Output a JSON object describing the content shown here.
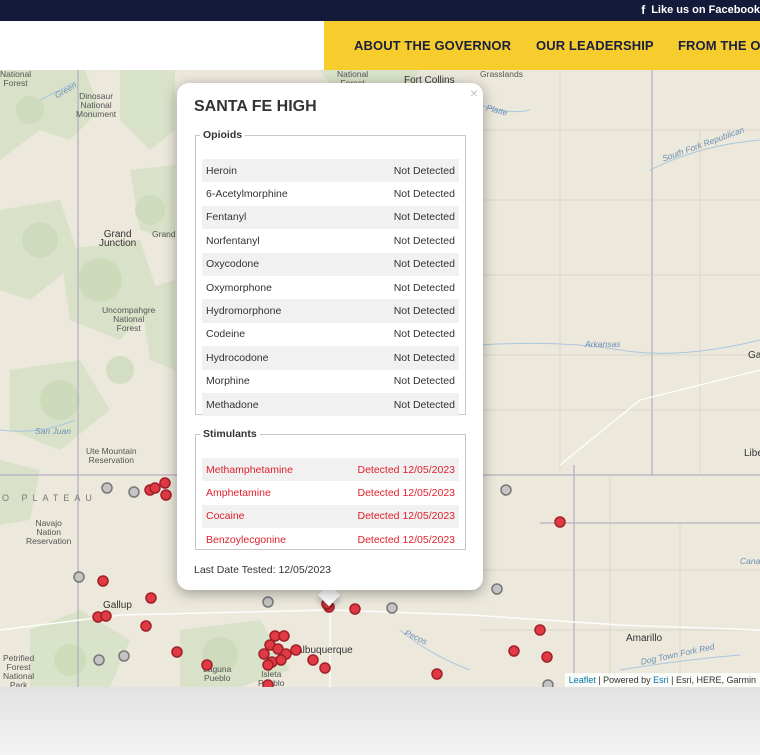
{
  "topbar": {
    "facebook_text": "Like us on Facebook",
    "facebook_icon": "facebook-icon"
  },
  "nav": {
    "items": [
      "ABOUT THE GOVERNOR",
      "OUR LEADERSHIP",
      "FROM THE OFFICE"
    ]
  },
  "colors": {
    "nav_bg": "#f7cd2e",
    "topbar_bg": "#141a3a",
    "detected": "#e0202c",
    "marker_red": "#e03a44",
    "marker_gray": "#999999"
  },
  "map": {
    "labels": {
      "national_forest": "National\nForest",
      "national_forest_top": "National\nForest",
      "fort_collins": "Fort Collins",
      "grasslands": "Grasslands",
      "dinosaur": "Dinosaur\nNational\nMonument",
      "grand_junction": "Grand\nJunction",
      "grand": "Grand",
      "uncompahgre": "Uncompahgre\nNational\nForest",
      "ute_mountain": "Ute Mountain\nReservation",
      "plateau": "O PLATEAU",
      "navajo": "Navajo\nNation\nReservation",
      "gallup": "Gallup",
      "petrified": "Petrified\nForest\nNational\nPark",
      "albuquerque": "Albuquerque",
      "laguna": "Laguna\nPueblo",
      "isleta": "Isleta\nPueblo",
      "amarillo": "Amarillo",
      "arkansas": "Arkansas",
      "south_fork": "South Fork Republican",
      "pecos": "Pecos",
      "san_juan": "San Juan",
      "dog_town": "Dog Town Fork Red",
      "green": "Green",
      "platte": "Platte",
      "ga": "Ga",
      "libe": "Libe",
      "cana": "Cana"
    },
    "attribution": {
      "leaflet": "Leaflet",
      "powered": " | Powered by ",
      "esri": "Esri",
      "rest": " | Esri, HERE, Garmin"
    }
  },
  "popup": {
    "title": "SANTA FE HIGH",
    "close_symbol": "×",
    "opioids": {
      "legend": "Opioids",
      "rows": [
        {
          "name": "Heroin",
          "status": "Not Detected"
        },
        {
          "name": "6-Acetylmorphine",
          "status": "Not Detected"
        },
        {
          "name": "Fentanyl",
          "status": "Not Detected"
        },
        {
          "name": "Norfentanyl",
          "status": "Not Detected"
        },
        {
          "name": "Oxycodone",
          "status": "Not Detected"
        },
        {
          "name": "Oxymorphone",
          "status": "Not Detected"
        },
        {
          "name": "Hydromorphone",
          "status": "Not Detected"
        },
        {
          "name": "Codeine",
          "status": "Not Detected"
        },
        {
          "name": "Hydrocodone",
          "status": "Not Detected"
        },
        {
          "name": "Morphine",
          "status": "Not Detected"
        },
        {
          "name": "Methadone",
          "status": "Not Detected"
        }
      ]
    },
    "stimulants": {
      "legend": "Stimulants",
      "rows": [
        {
          "name": "Methamphetamine",
          "status": "Detected 12/05/2023"
        },
        {
          "name": "Amphetamine",
          "status": "Detected 12/05/2023"
        },
        {
          "name": "Cocaine",
          "status": "Detected 12/05/2023"
        },
        {
          "name": "Benzoylecgonine",
          "status": "Detected 12/05/2023"
        }
      ]
    },
    "last_tested": "Last Date Tested: 12/05/2023"
  }
}
